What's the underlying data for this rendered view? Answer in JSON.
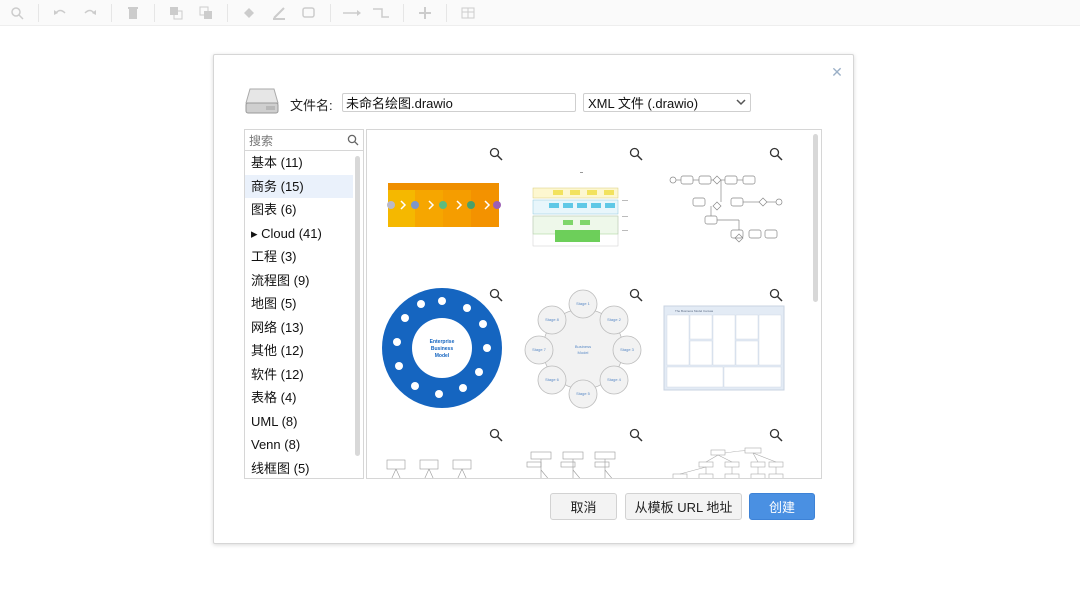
{
  "toolbar": {
    "icons": [
      "zoom-icon",
      "undo-icon",
      "redo-icon",
      "delete-icon",
      "to-front-icon",
      "to-back-icon",
      "fill-color-icon",
      "line-color-icon",
      "shadow-icon",
      "connection-icon",
      "waypoints-icon",
      "insert-icon",
      "table-icon"
    ]
  },
  "dialog": {
    "filename_label": "文件名:",
    "filename_value": "未命名绘图.drawio",
    "format_value": "XML 文件 (.drawio)",
    "search_placeholder": "搜索",
    "categories": [
      {
        "label": "基本 (11)"
      },
      {
        "label": "商务 (15)"
      },
      {
        "label": "图表 (6)"
      },
      {
        "label": "▸ Cloud (41)"
      },
      {
        "label": "工程 (3)"
      },
      {
        "label": "流程图 (9)"
      },
      {
        "label": "地图 (5)"
      },
      {
        "label": "网络 (13)"
      },
      {
        "label": "其他 (12)"
      },
      {
        "label": "软件 (12)"
      },
      {
        "label": "表格 (4)"
      },
      {
        "label": "UML (8)"
      },
      {
        "label": "Venn (8)"
      },
      {
        "label": "线框图 (5)"
      }
    ],
    "selected_category": "商务 (15)",
    "templates": {
      "enterprise": {
        "title_1": "Enterprise",
        "title_2": "Business",
        "title_3": "Model"
      },
      "stages": {
        "center_1": "Business",
        "center_2": "Model",
        "stages": [
          "Stage 1",
          "Stage 2",
          "Stage 3",
          "Stage 4",
          "Stage 5",
          "Stage 6",
          "Stage 7",
          "Stage 8"
        ]
      },
      "canvas": {
        "title": "The Business Model Canvas"
      }
    },
    "buttons": {
      "cancel": "取消",
      "from_url": "从模板 URL 地址",
      "create": "创建"
    },
    "colors": {
      "accent": "#4a90e2",
      "selected_bg": "#eaf1fb",
      "enterprise_blue": "#1565c0",
      "stream_yellow": "#f5b800",
      "stream_orange": "#f39200"
    }
  }
}
